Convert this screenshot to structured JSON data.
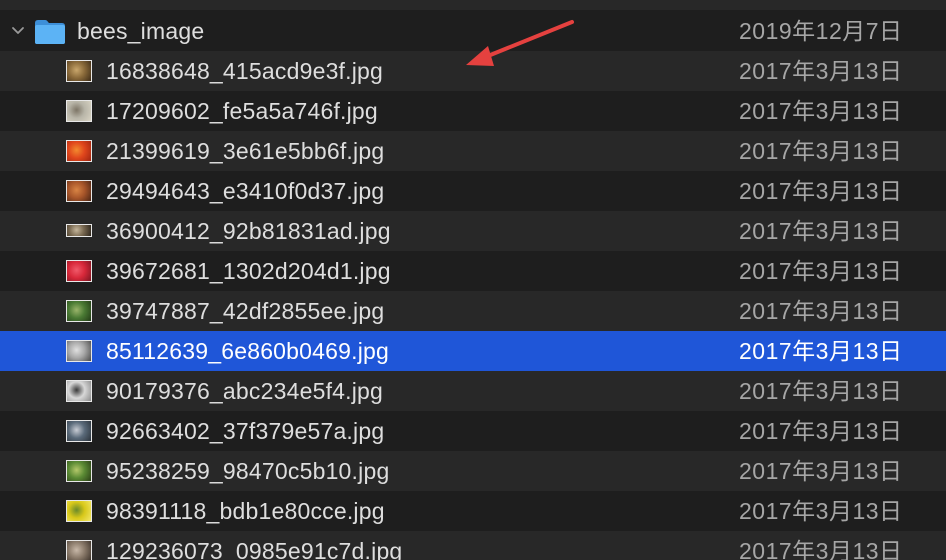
{
  "colors": {
    "background": "#1e1e1e",
    "row_alt": "#282828",
    "selection": "#1f56d8",
    "text": "#dedede",
    "date_text": "#a6a6a6",
    "folder_blue": "#4aa8f0",
    "arrow_red": "#e5413f"
  },
  "folder": {
    "name": "bees_image",
    "date": "2019年12月7日",
    "icon": "folder-icon",
    "disclosure_icon": "chevron-down-icon",
    "expanded": true
  },
  "files": [
    {
      "name": "16838648_415acd9e3f.jpg",
      "date": "2017年3月13日",
      "selected": false,
      "thumb": [
        "#8a6a3a",
        "#c9a66b",
        "#3b2a16"
      ]
    },
    {
      "name": "17209602_fe5a5a746f.jpg",
      "date": "2017年3月13日",
      "selected": false,
      "thumb": [
        "#b8b5a8",
        "#7d7566",
        "#d9d4c4"
      ]
    },
    {
      "name": "21399619_3e61e5bb6f.jpg",
      "date": "2017年3月13日",
      "selected": false,
      "thumb": [
        "#e0461c",
        "#f28a2e",
        "#9e2410"
      ]
    },
    {
      "name": "29494643_e3410f0d37.jpg",
      "date": "2017年3月13日",
      "selected": false,
      "thumb": [
        "#a8562a",
        "#d88444",
        "#4a2414"
      ]
    },
    {
      "name": "36900412_92b81831ad.jpg",
      "date": "2017年3月13日",
      "selected": false,
      "thumb": [
        "#7a6a52",
        "#c4b59a",
        "#2e261c"
      ]
    },
    {
      "name": "39672681_1302d204d1.jpg",
      "date": "2017年3月13日",
      "selected": false,
      "thumb": [
        "#d8283a",
        "#f05a6a",
        "#7a1420"
      ]
    },
    {
      "name": "39747887_42df2855ee.jpg",
      "date": "2017年3月13日",
      "selected": false,
      "thumb": [
        "#4a7a34",
        "#9ab46a",
        "#223a16"
      ]
    },
    {
      "name": "85112639_6e860b0469.jpg",
      "date": "2017年3月13日",
      "selected": true,
      "thumb": [
        "#a8a8a8",
        "#e0e0e0",
        "#4a4a4a"
      ]
    },
    {
      "name": "90179376_abc234e5f4.jpg",
      "date": "2017年3月13日",
      "selected": false,
      "thumb": [
        "#d8d8d8",
        "#3a3a3a",
        "#8a8a8a"
      ]
    },
    {
      "name": "92663402_37f379e57a.jpg",
      "date": "2017年3月13日",
      "selected": false,
      "thumb": [
        "#5a6a7a",
        "#c8ccd4",
        "#2a323a"
      ]
    },
    {
      "name": "95238259_98470c5b10.jpg",
      "date": "2017年3月13日",
      "selected": false,
      "thumb": [
        "#5a8a34",
        "#b4c86a",
        "#2a3e16"
      ]
    },
    {
      "name": "98391118_bdb1e80cce.jpg",
      "date": "2017年3月13日",
      "selected": false,
      "thumb": [
        "#d8c81a",
        "#6a8a2a",
        "#f4e86a"
      ]
    },
    {
      "name": "129236073_0985e91c7d.jpg",
      "date": "2017年3月13日",
      "selected": false,
      "thumb": [
        "#8a7a6a",
        "#c8b8a8",
        "#3a3028"
      ]
    }
  ],
  "annotation": {
    "arrow_icon": "red-arrow-icon",
    "points_to": "16838648_415acd9e3f.jpg"
  }
}
